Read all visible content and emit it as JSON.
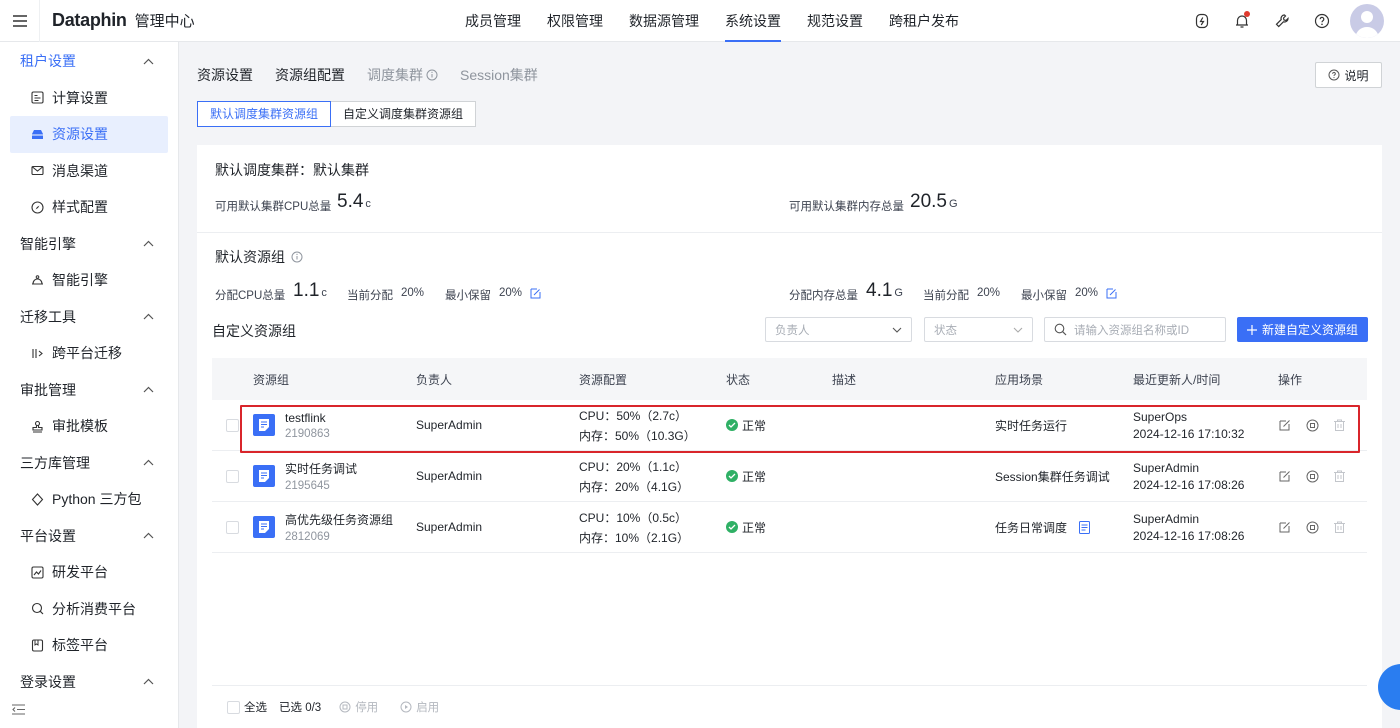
{
  "header": {
    "brand": "Dataphin",
    "subtitle": "管理中心",
    "nav": [
      "成员管理",
      "权限管理",
      "数据源管理",
      "系统设置",
      "规范设置",
      "跨租户发布"
    ],
    "active_nav": "系统设置",
    "icons": [
      "cloud-bolt-icon",
      "bell-icon",
      "wrench-icon",
      "help-icon"
    ]
  },
  "sidebar": {
    "groups": [
      {
        "label": "租户设置",
        "items": [
          "计算设置",
          "资源设置",
          "消息渠道",
          "样式配置"
        ]
      },
      {
        "label": "智能引擎",
        "items": [
          "智能引擎"
        ]
      },
      {
        "label": "迁移工具",
        "items": [
          "跨平台迁移"
        ]
      },
      {
        "label": "审批管理",
        "items": [
          "审批模板"
        ]
      },
      {
        "label": "三方库管理",
        "items": [
          "Python 三方包"
        ]
      },
      {
        "label": "平台设置",
        "items": [
          "研发平台",
          "分析消费平台",
          "标签平台"
        ]
      },
      {
        "label": "登录设置",
        "items": []
      }
    ],
    "active_item": "资源设置"
  },
  "tabs": {
    "items": [
      "资源设置",
      "资源组配置",
      "调度集群",
      "Session集群"
    ],
    "help": "说明"
  },
  "segment": {
    "left": "默认调度集群资源组",
    "right": "自定义调度集群资源组"
  },
  "cluster": {
    "title": "默认调度集群：默认集群",
    "cpu_label": "可用默认集群CPU总量",
    "cpu_value": "5.4",
    "cpu_unit": "c",
    "mem_label": "可用默认集群内存总量",
    "mem_value": "20.5",
    "mem_unit": "G"
  },
  "default_group": {
    "title": "默认资源组",
    "cpu_label": "分配CPU总量",
    "cpu_value": "1.1",
    "cpu_unit": "c",
    "cur_label": "当前分配",
    "cur_value": "20%",
    "min_label": "最小保留",
    "min_value": "20%",
    "mem_label": "分配内存总量",
    "mem_value": "4.1",
    "mem_unit": "G",
    "mcur_label": "当前分配",
    "mcur_value": "20%",
    "mmin_label": "最小保留",
    "mmin_value": "20%"
  },
  "custom": {
    "title": "自定义资源组",
    "owner_placeholder": "负责人",
    "status_placeholder": "状态",
    "search_placeholder": "请输入资源组名称或ID",
    "new_button": "新建自定义资源组"
  },
  "table": {
    "columns": [
      "资源组",
      "负责人",
      "资源配置",
      "状态",
      "描述",
      "应用场景",
      "最近更新人/时间",
      "操作"
    ],
    "rows": [
      {
        "name": "testflink",
        "id": "2190863",
        "owner": "SuperAdmin",
        "cpu": "CPU：50%（2.7c）",
        "mem": "内存：50%（10.3G）",
        "status": "正常",
        "desc": "",
        "scene": "实时任务运行",
        "updater": "SuperOps",
        "time": "2024-12-16 17:10:32"
      },
      {
        "name": "实时任务调试",
        "id": "2195645",
        "owner": "SuperAdmin",
        "cpu": "CPU：20%（1.1c）",
        "mem": "内存：20%（4.1G）",
        "status": "正常",
        "desc": "",
        "scene": "Session集群任务调试",
        "updater": "SuperAdmin",
        "time": "2024-12-16 17:08:26"
      },
      {
        "name": "高优先级任务资源组",
        "id": "2812069",
        "owner": "SuperAdmin",
        "cpu": "CPU：10%（0.5c）",
        "mem": "内存：10%（2.1G）",
        "status": "正常",
        "desc": "",
        "scene": "任务日常调度",
        "updater": "SuperAdmin",
        "time": "2024-12-16 17:08:26"
      }
    ]
  },
  "footer": {
    "select_all": "全选",
    "selected": "已选 0/3",
    "disable": "停用",
    "enable": "启用"
  },
  "colors": {
    "accent": "#3a6ff6",
    "success": "#2fb065",
    "highlight": "#d9252b"
  }
}
